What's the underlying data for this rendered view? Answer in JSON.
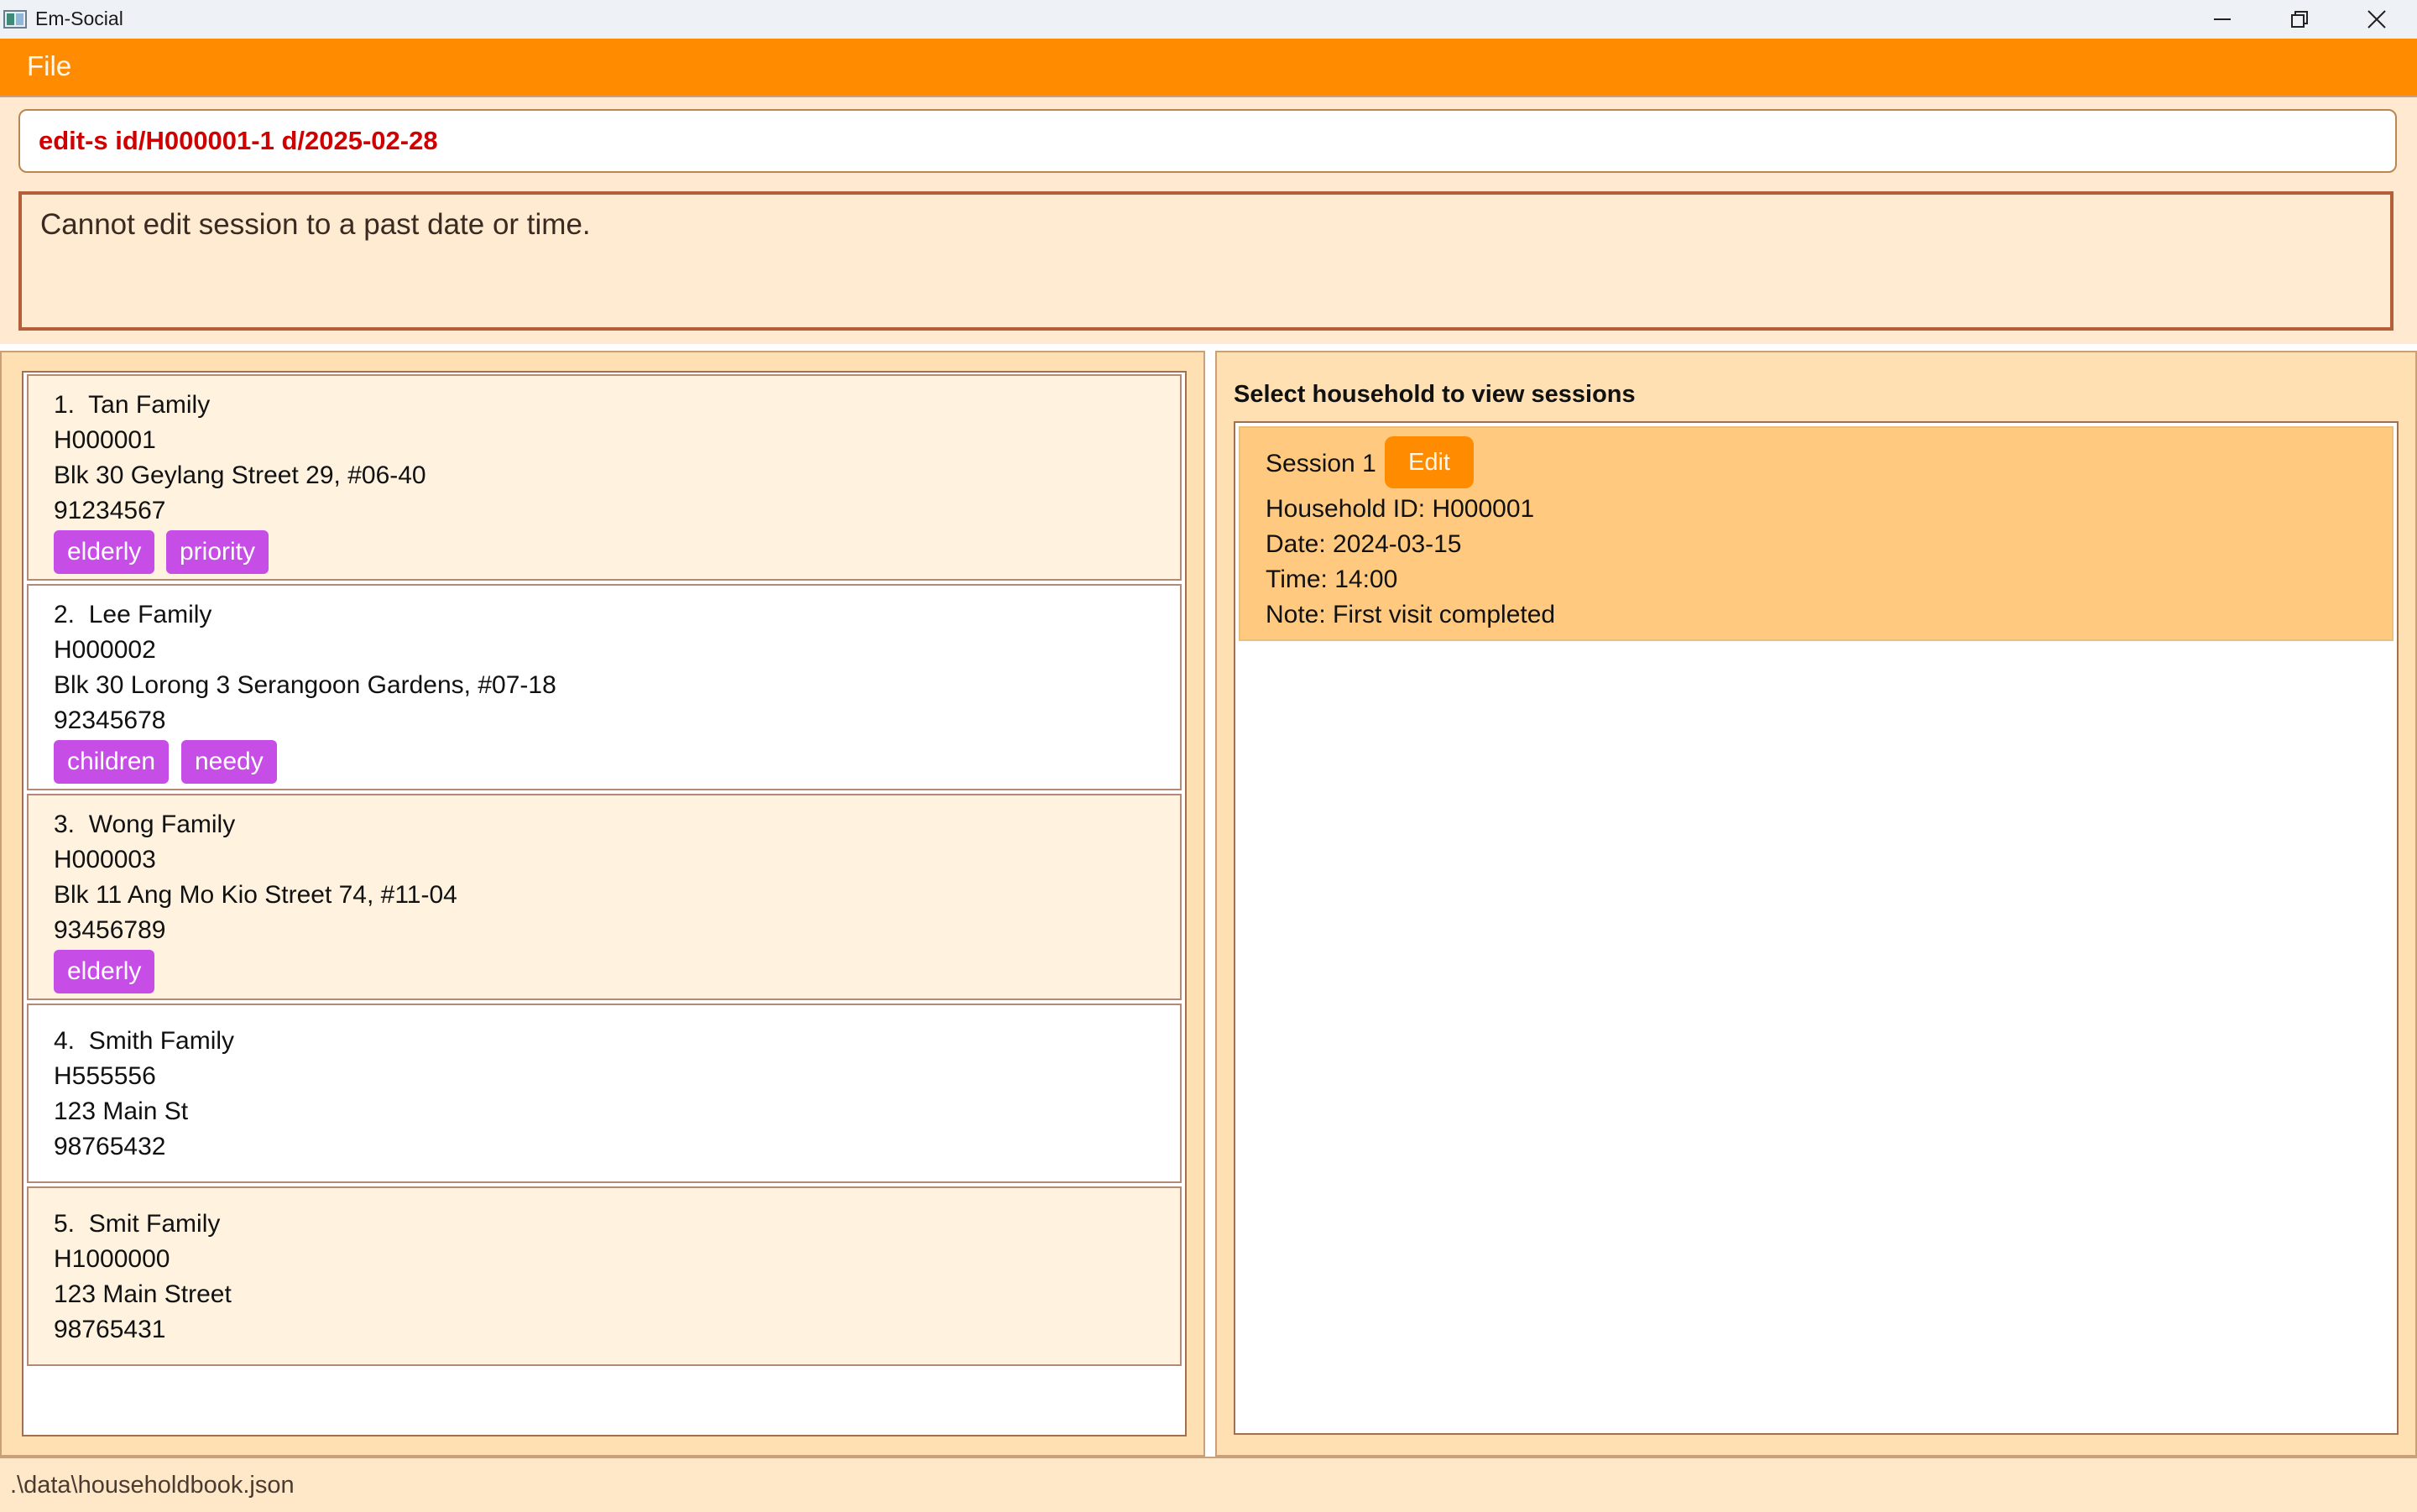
{
  "window": {
    "title": "Em-Social",
    "controls": [
      "minimize-icon",
      "restore-icon",
      "close-icon"
    ]
  },
  "menu": {
    "file_label": "File"
  },
  "command_box": {
    "value": "edit-s id/H000001-1 d/2025-02-28"
  },
  "result_display": {
    "message": "Cannot edit session to a past date or time."
  },
  "households": [
    {
      "index": "1.",
      "name": "Tan Family",
      "id": "H000001",
      "address": "Blk 30 Geylang Street 29, #06-40",
      "phone": "91234567",
      "tags": [
        "elderly",
        "priority"
      ]
    },
    {
      "index": "2.",
      "name": "Lee Family",
      "id": "H000002",
      "address": "Blk 30 Lorong 3 Serangoon Gardens, #07-18",
      "phone": "92345678",
      "tags": [
        "children",
        "needy"
      ]
    },
    {
      "index": "3.",
      "name": "Wong Family",
      "id": "H000003",
      "address": "Blk 11 Ang Mo Kio Street 74, #11-04",
      "phone": "93456789",
      "tags": [
        "elderly"
      ]
    },
    {
      "index": "4.",
      "name": "Smith Family",
      "id": "H555556",
      "address": "123 Main St",
      "phone": "98765432",
      "tags": []
    },
    {
      "index": "5.",
      "name": "Smit Family",
      "id": "H1000000",
      "address": "123 Main Street",
      "phone": "98765431",
      "tags": []
    }
  ],
  "sessions_panel": {
    "header": "Select household to view sessions",
    "sessions": [
      {
        "title": "Session 1",
        "edit_label": "Edit",
        "household_id": "Household ID: H000001",
        "date": "Date: 2024-03-15",
        "time": "Time: 14:00",
        "note": "Note: First visit completed"
      }
    ]
  },
  "status_bar": {
    "path": ".\\data\\householdbook.json"
  },
  "colors": {
    "accent": "#ff8c00",
    "tag": "#c64de6",
    "command_text": "#d10000",
    "session_card": "#ffca80"
  }
}
